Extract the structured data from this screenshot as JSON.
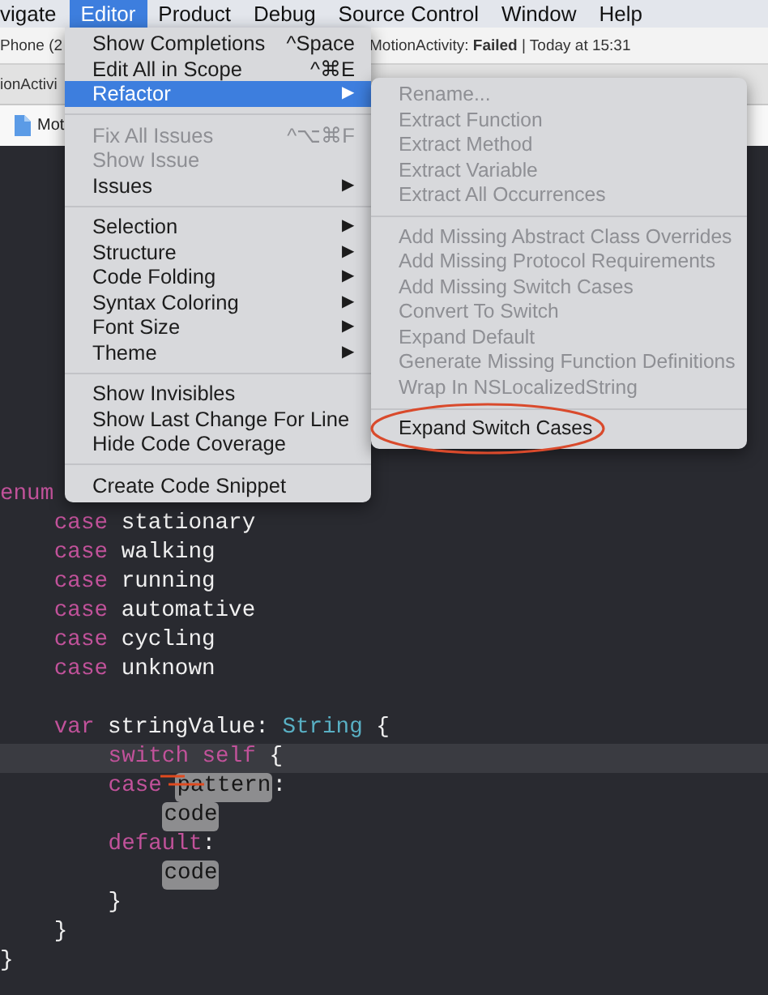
{
  "menu_bar": [
    {
      "label": "vigate",
      "selected": false
    },
    {
      "label": "Editor",
      "selected": true
    },
    {
      "label": "Product",
      "selected": false
    },
    {
      "label": "Debug",
      "selected": false
    },
    {
      "label": "Source Control",
      "selected": false
    },
    {
      "label": "Window",
      "selected": false
    },
    {
      "label": "Help",
      "selected": false
    }
  ],
  "toolbar": {
    "device": "Phone (2",
    "status": "MotionActivity: **Failed** | Today at 15:31"
  },
  "tab_bar": {
    "tab": "ionActivi"
  },
  "jump_bar": {
    "file": "Mot"
  },
  "editor_menu": {
    "sections": [
      [
        {
          "label": "Show Completions",
          "shortcut": "^Space",
          "disabled": false,
          "selected": false
        },
        {
          "label": "Edit All in Scope",
          "shortcut": "^⌘E",
          "disabled": false,
          "selected": false
        },
        {
          "label": "Refactor",
          "submenu_arrow": "▶",
          "disabled": false,
          "selected": true
        }
      ],
      [
        {
          "label": "Fix All Issues",
          "shortcut": "^⌥⌘F",
          "disabled": true,
          "selected": false
        },
        {
          "label": "Show Issue",
          "disabled": true,
          "selected": false
        },
        {
          "label": "Issues",
          "submenu_arrow": "▶",
          "disabled": false,
          "selected": false
        }
      ],
      [
        {
          "label": "Selection",
          "submenu_arrow": "▶",
          "disabled": false,
          "selected": false
        },
        {
          "label": "Structure",
          "submenu_arrow": "▶",
          "disabled": false,
          "selected": false
        },
        {
          "label": "Code Folding",
          "submenu_arrow": "▶",
          "disabled": false,
          "selected": false
        },
        {
          "label": "Syntax Coloring",
          "submenu_arrow": "▶",
          "disabled": false,
          "selected": false
        },
        {
          "label": "Font Size",
          "submenu_arrow": "▶",
          "disabled": false,
          "selected": false
        },
        {
          "label": "Theme",
          "submenu_arrow": "▶",
          "disabled": false,
          "selected": false
        }
      ],
      [
        {
          "label": "Show Invisibles",
          "disabled": false,
          "selected": false
        },
        {
          "label": "Show Last Change For Line",
          "disabled": false,
          "selected": false
        },
        {
          "label": "Hide Code Coverage",
          "disabled": false,
          "selected": false
        }
      ],
      [
        {
          "label": "Create Code Snippet",
          "disabled": false,
          "selected": false
        }
      ]
    ]
  },
  "refactor_submenu": {
    "sections": [
      [
        {
          "label": "Rename...",
          "disabled": true,
          "selected": false
        },
        {
          "label": "Extract Function",
          "disabled": true,
          "selected": false
        },
        {
          "label": "Extract Method",
          "disabled": true,
          "selected": false
        },
        {
          "label": "Extract Variable",
          "disabled": true,
          "selected": false
        },
        {
          "label": "Extract All Occurrences",
          "disabled": true,
          "selected": false
        }
      ],
      [
        {
          "label": "Add Missing Abstract Class Overrides",
          "disabled": true,
          "selected": false
        },
        {
          "label": "Add Missing Protocol Requirements",
          "disabled": true,
          "selected": false
        },
        {
          "label": "Add Missing Switch Cases",
          "disabled": true,
          "selected": false
        },
        {
          "label": "Convert To Switch",
          "disabled": true,
          "selected": false
        },
        {
          "label": "Expand Default",
          "disabled": true,
          "selected": false
        },
        {
          "label": "Generate Missing Function Definitions",
          "disabled": true,
          "selected": false
        },
        {
          "label": "Wrap In NSLocalizedString",
          "disabled": true,
          "selected": false
        }
      ],
      [
        {
          "label": "Expand Switch Cases",
          "disabled": false,
          "selected": false
        }
      ]
    ]
  },
  "code": {
    "lines": [
      {
        "kind": "code",
        "current": false,
        "tokens": [
          {
            "text": "enum",
            "kind": "keyword"
          }
        ],
        "children": [
          {
            "kind": "code",
            "current": false,
            "tokens": [
              {
                "text": "case",
                "kind": "keyword"
              },
              {
                "text": "stationary",
                "kind": "plain"
              }
            ]
          },
          {
            "kind": "code",
            "current": false,
            "tokens": [
              {
                "text": "case",
                "kind": "keyword"
              },
              {
                "text": "walking",
                "kind": "plain"
              }
            ]
          },
          {
            "kind": "code",
            "current": false,
            "tokens": [
              {
                "text": "case",
                "kind": "keyword"
              },
              {
                "text": "running",
                "kind": "plain"
              }
            ]
          },
          {
            "kind": "code",
            "current": false,
            "tokens": [
              {
                "text": "case",
                "kind": "keyword"
              },
              {
                "text": "automative",
                "kind": "plain"
              }
            ]
          },
          {
            "kind": "code",
            "current": false,
            "tokens": [
              {
                "text": "case",
                "kind": "keyword"
              },
              {
                "text": "cycling",
                "kind": "plain"
              }
            ]
          },
          {
            "kind": "code",
            "current": false,
            "tokens": [
              {
                "text": "case",
                "kind": "keyword"
              },
              {
                "text": "unknown",
                "kind": "plain"
              }
            ]
          },
          {
            "kind": "blank"
          },
          {
            "kind": "code",
            "current": false,
            "tokens": [
              {
                "text": "var",
                "kind": "keyword"
              },
              {
                "text": "stringValue:",
                "kind": "plain"
              },
              {
                "text": "String",
                "kind": "type"
              },
              {
                "text": "{",
                "kind": "plain"
              }
            ],
            "children": [
              {
                "kind": "code",
                "current": true,
                "tokens": [
                  {
                    "text": "switch",
                    "kind": "keyword"
                  },
                  {
                    "text": "self",
                    "kind": "keyword"
                  },
                  {
                    "text": "{",
                    "kind": "plain"
                  }
                ]
              },
              {
                "kind": "code",
                "current": false,
                "tokens": [
                  {
                    "text": "case",
                    "kind": "keyword"
                  },
                  {
                    "text": "pattern",
                    "kind": "placeholder"
                  },
                  {
                    "text": ":",
                    "kind": "plain"
                  }
                ],
                "children": [
                  {
                    "kind": "code",
                    "current": false,
                    "tokens": [
                      {
                        "text": "code",
                        "kind": "placeholder"
                      }
                    ]
                  }
                ]
              },
              {
                "kind": "code",
                "current": false,
                "tokens": [
                  {
                    "text": "default",
                    "kind": "keyword"
                  },
                  {
                    "text": ":",
                    "kind": "plain"
                  }
                ],
                "children": [
                  {
                    "kind": "code",
                    "current": false,
                    "tokens": [
                      {
                        "text": "code",
                        "kind": "placeholder"
                      }
                    ]
                  }
                ]
              },
              {
                "kind": "code",
                "current": false,
                "tokens": [
                  {
                    "text": "}",
                    "kind": "plain"
                  }
                ]
              }
            ]
          },
          {
            "kind": "code",
            "current": false,
            "tokens": [
              {
                "text": "}",
                "kind": "plain"
              }
            ]
          }
        ]
      },
      {
        "kind": "code",
        "current": false,
        "tokens": [
          {
            "text": "}",
            "kind": "plain"
          }
        ]
      }
    ]
  }
}
